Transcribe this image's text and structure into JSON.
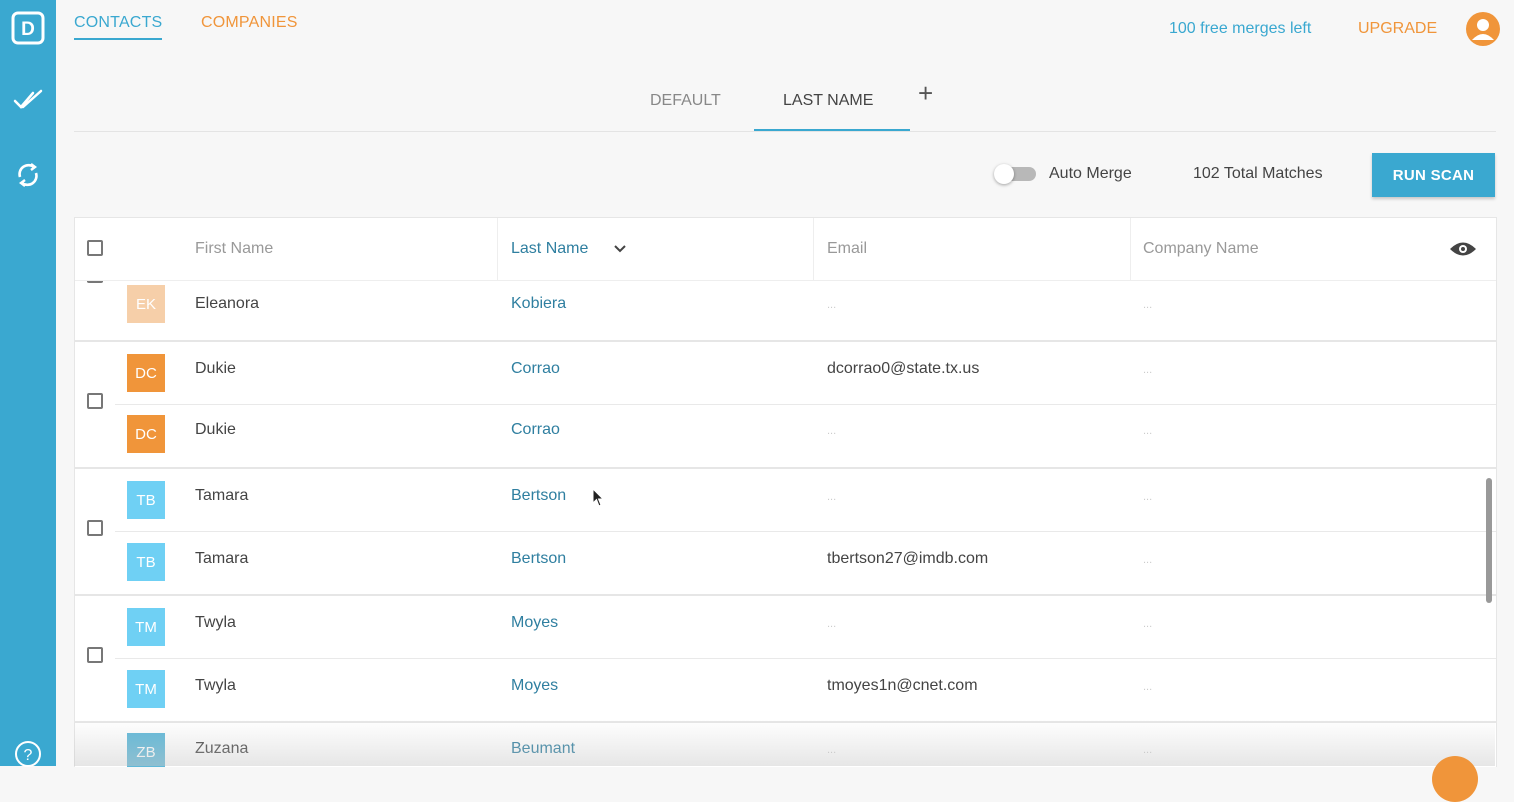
{
  "sidebar": {
    "logo_letter": "D",
    "items": [
      {
        "icon": "logo-icon"
      },
      {
        "icon": "double-check-icon"
      },
      {
        "icon": "sync-icon"
      },
      {
        "icon": "help-icon"
      }
    ],
    "color": "#3aa8d0"
  },
  "topnav": {
    "tabs": [
      {
        "label": "CONTACTS",
        "active": true
      },
      {
        "label": "COMPANIES",
        "active": false
      }
    ],
    "merges_left": "100 free merges left",
    "upgrade": "UPGRADE",
    "user_icon": "user-avatar-icon"
  },
  "subtabs": {
    "items": [
      {
        "label": "DEFAULT",
        "active": false
      },
      {
        "label": "LAST NAME",
        "active": true
      }
    ],
    "add": "+"
  },
  "toolbar": {
    "auto_merge_label": "Auto Merge",
    "auto_merge_on": false,
    "total_matches": "102 Total Matches",
    "run_scan": "RUN SCAN"
  },
  "table": {
    "headers": {
      "first": "First Name",
      "last": "Last Name",
      "email": "Email",
      "company": "Company Name"
    },
    "sorted_by": "Last Name",
    "rows": [
      {
        "initials": "EK",
        "color": "#f3bc86",
        "first": "Eleanora",
        "last": "Kobiera",
        "email": "...",
        "company": "..."
      },
      {
        "initials": "DC",
        "color": "#f0953a",
        "first": "Dukie",
        "last": "Corrao",
        "email": "dcorrao0@state.tx.us",
        "company": "..."
      },
      {
        "initials": "DC",
        "color": "#f0953a",
        "first": "Dukie",
        "last": "Corrao",
        "email": "...",
        "company": "..."
      },
      {
        "initials": "TB",
        "color": "#6fd0f4",
        "first": "Tamara",
        "last": "Bertson",
        "email": "...",
        "company": "..."
      },
      {
        "initials": "TB",
        "color": "#6fd0f4",
        "first": "Tamara",
        "last": "Bertson",
        "email": "tbertson27@imdb.com",
        "company": "..."
      },
      {
        "initials": "TM",
        "color": "#6fd0f4",
        "first": "Twyla",
        "last": "Moyes",
        "email": "...",
        "company": "..."
      },
      {
        "initials": "TM",
        "color": "#6fd0f4",
        "first": "Twyla",
        "last": "Moyes",
        "email": "tmoyes1n@cnet.com",
        "company": "..."
      },
      {
        "initials": "ZB",
        "color": "#5fb8d8",
        "first": "Zuzana",
        "last": "Beumant",
        "email": "...",
        "company": "..."
      }
    ]
  }
}
